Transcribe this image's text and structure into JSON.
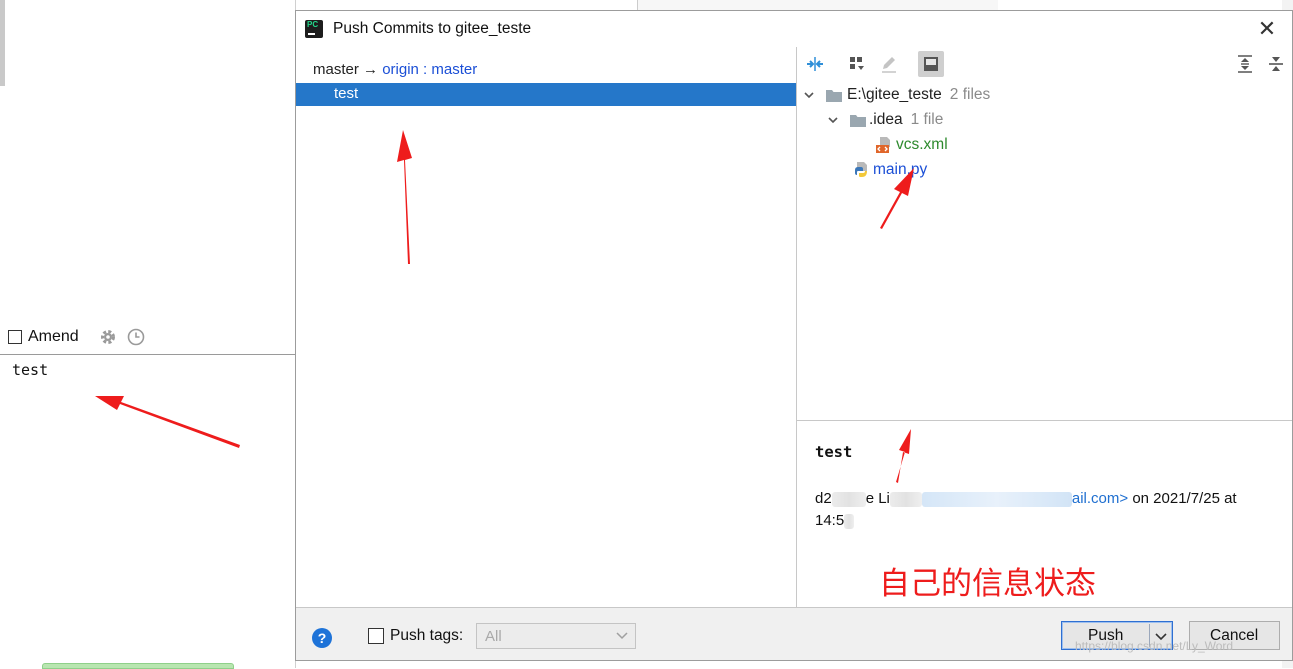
{
  "background": {
    "amend_label": "Amend",
    "commit_message": "test"
  },
  "dialog": {
    "title": "Push Commits to gitee_teste",
    "app_icon_text": "PC",
    "branch": {
      "local": "master",
      "arrow": "→",
      "remote": "origin",
      "separator": ":",
      "remote_branch": "master"
    },
    "commits": [
      {
        "label": "test",
        "selected": true
      }
    ],
    "tree": {
      "root": {
        "label": "E:\\gitee_teste",
        "count": "2 files"
      },
      "folder": {
        "label": ".idea",
        "count": "1 file"
      },
      "files": [
        {
          "label": "vcs.xml",
          "color": "#2d8a2d",
          "icon": "xml-file-icon"
        },
        {
          "label": "main.py",
          "color": "#1b4fd6",
          "icon": "python-file-icon"
        }
      ]
    },
    "details": {
      "title": "test",
      "author_prefix": "d2",
      "author_mid": "e Li",
      "email_tail": "ail.com>",
      "date_text": " on 2021/7/25 at",
      "time_text": "14:5"
    },
    "annotation": "自己的信息状态",
    "footer": {
      "help": "?",
      "push_tags_label": "Push tags:",
      "tags_value": "All",
      "push_label": "Push",
      "cancel_label": "Cancel"
    }
  },
  "watermark": "https://blog.csdn.net/Ly_Word",
  "colors": {
    "selection": "#2577c9",
    "link": "#1b4fd6",
    "annotation": "#ee1c1c",
    "footer_bg": "#f0f0f0"
  }
}
